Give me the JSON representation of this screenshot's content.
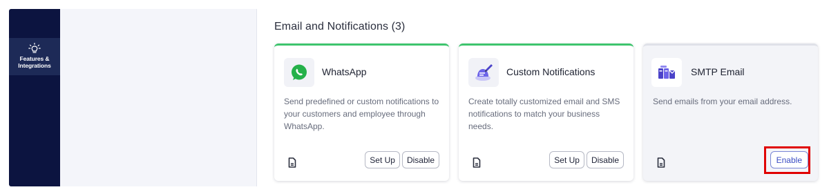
{
  "nav": {
    "items": [
      {
        "label": "Features & Integrations",
        "icon": "lightbulb-icon",
        "active": true
      }
    ]
  },
  "section": {
    "title": "Email and Notifications (3)"
  },
  "cards": [
    {
      "name": "WhatsApp",
      "icon": "whatsapp-icon",
      "description": "Send predefined or custom notifications to your customers and employee through WhatsApp.",
      "status": "enabled",
      "buttons": [
        "Set Up",
        "Disable"
      ]
    },
    {
      "name": "Custom Notifications",
      "icon": "custom-notifications-icon",
      "description": "Create totally customized email and SMS notifications to match your business needs.",
      "status": "enabled",
      "buttons": [
        "Set Up",
        "Disable"
      ]
    },
    {
      "name": "SMTP Email",
      "icon": "smtp-email-icon",
      "description": "Send emails from your email address.",
      "status": "disabled",
      "buttons": [
        "Enable"
      ]
    }
  ],
  "colors": {
    "nav_bg": "#0c1440",
    "nav_active_bg": "#1d2a57",
    "active_accent": "#3ec46d",
    "whatsapp_green": "#25b14a",
    "brand_purple": "#6c63e8",
    "enable_text": "#3b4dc4",
    "highlight_red": "#e00000"
  }
}
